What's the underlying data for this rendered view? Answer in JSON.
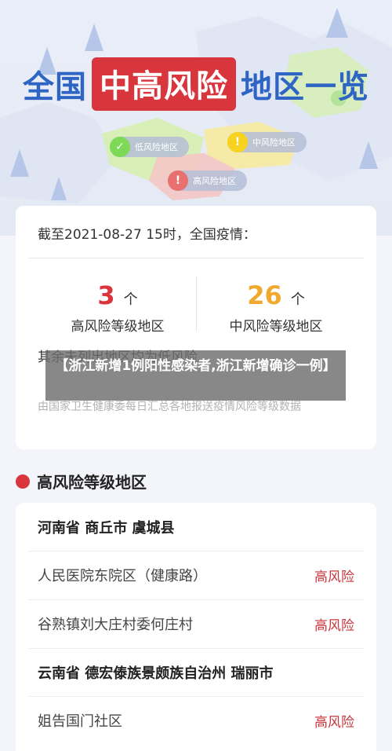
{
  "header": {
    "title_left": "全国",
    "title_highlight": "中高风险",
    "title_right": "地区一览",
    "legend": [
      {
        "label": "低风险地区",
        "color": "#7ed957",
        "symbol": "✓"
      },
      {
        "label": "中风险地区",
        "color": "#f7d21e",
        "symbol": "!"
      },
      {
        "label": "高风险地区",
        "color": "#e8716f",
        "symbol": "!"
      }
    ]
  },
  "summary": {
    "heading": "截至2021-08-27 15时，全国疫情：",
    "high": {
      "count": "3",
      "unit": "个",
      "label": "高风险等级地区",
      "color": "#d9353c"
    },
    "medium": {
      "count": "26",
      "unit": "个",
      "label": "中风险等级地区",
      "color": "#f0a92e"
    },
    "low_text": "其余未列出地区均为低风险",
    "source": "由国家卫生健康委每日汇总各地报送疫情风险等级数据"
  },
  "caption": "【浙江新增1例阳性感染者,浙江新增确诊一例】",
  "high_section": {
    "title": "高风险等级地区",
    "rows": [
      {
        "text": "河南省 商丘市 虞城县",
        "type": "region"
      },
      {
        "text": "人民医院东院区（健康路）",
        "type": "item",
        "risk": "高风险"
      },
      {
        "text": "谷熟镇刘大庄村委何庄村",
        "type": "item",
        "risk": "高风险"
      },
      {
        "text": "云南省 德宏傣族景颇族自治州 瑞丽市",
        "type": "region"
      },
      {
        "text": "姐告国门社区",
        "type": "item",
        "risk": "高风险"
      }
    ]
  }
}
